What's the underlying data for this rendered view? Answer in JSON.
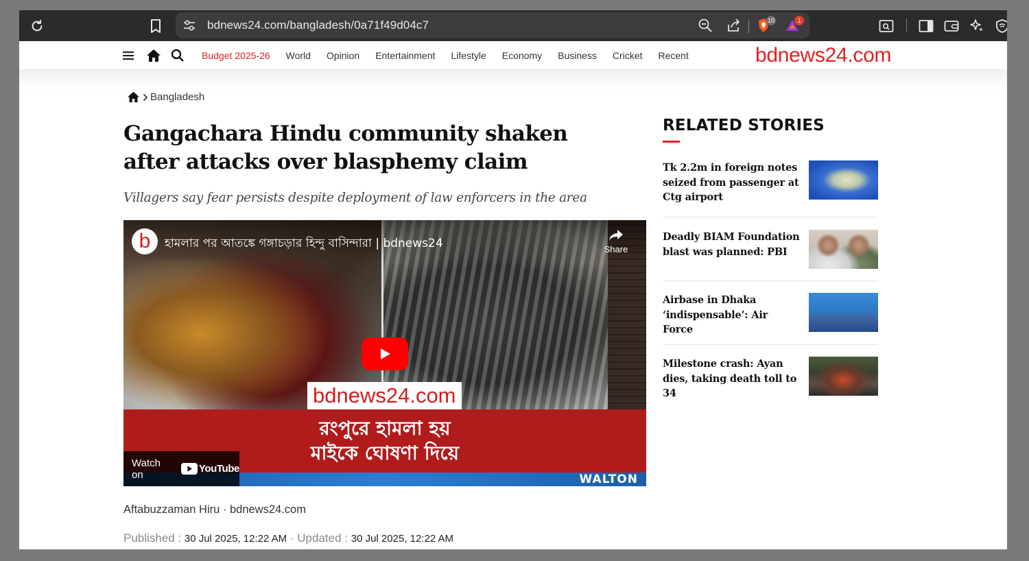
{
  "browser": {
    "url": "bdnews24.com/bangladesh/0a71f49d04c7",
    "brave_shield_count": "10",
    "rewards_count": "1"
  },
  "nav": {
    "links": [
      {
        "label": "Budget 2025-26",
        "highlight": true
      },
      {
        "label": "World"
      },
      {
        "label": "Opinion"
      },
      {
        "label": "Entertainment"
      },
      {
        "label": "Lifestyle"
      },
      {
        "label": "Economy"
      },
      {
        "label": "Business"
      },
      {
        "label": "Cricket"
      },
      {
        "label": "Recent"
      }
    ],
    "logo": "bdnews24.com"
  },
  "breadcrumb": {
    "section": "Bangladesh"
  },
  "article": {
    "headline": "Gangachara Hindu community shaken after attacks over blasphemy claim",
    "subhead": "Villagers say fear persists despite deployment of law enforcers in the area",
    "byline": "Aftabuzzaman Hiru · bdnews24.com",
    "published_label": "Published :",
    "published_value": "30 Jul 2025, 12:22 AM",
    "updated_label": "Updated :",
    "updated_value": "30 Jul 2025, 12:22 AM"
  },
  "video": {
    "channel_letter": "b",
    "title": "হামলার পর আতঙ্কে গঙ্গাচড়ার হিন্দু বাসিন্দারা | bdnews24",
    "share_label": "Share",
    "watermark": "bdnews24.com",
    "band_line1": "রংপুরে হামলা হয়",
    "band_line2": "মাইকে ঘোষণা দিয়ে",
    "watch_on": "Watch on",
    "youtube": "YouTube",
    "ad_brand": "WALTON"
  },
  "related": {
    "heading": "RELATED STORIES",
    "accent": "#e02020",
    "items": [
      {
        "title": "Tk 2.2m in foreign notes seized from passenger at Ctg airport"
      },
      {
        "title": "Deadly BIAM Foundation blast was planned: PBI"
      },
      {
        "title": "Airbase in Dhaka ‘indispensable’: Air Force"
      },
      {
        "title": "Milestone crash: Ayan dies, taking death toll to 34"
      }
    ]
  }
}
